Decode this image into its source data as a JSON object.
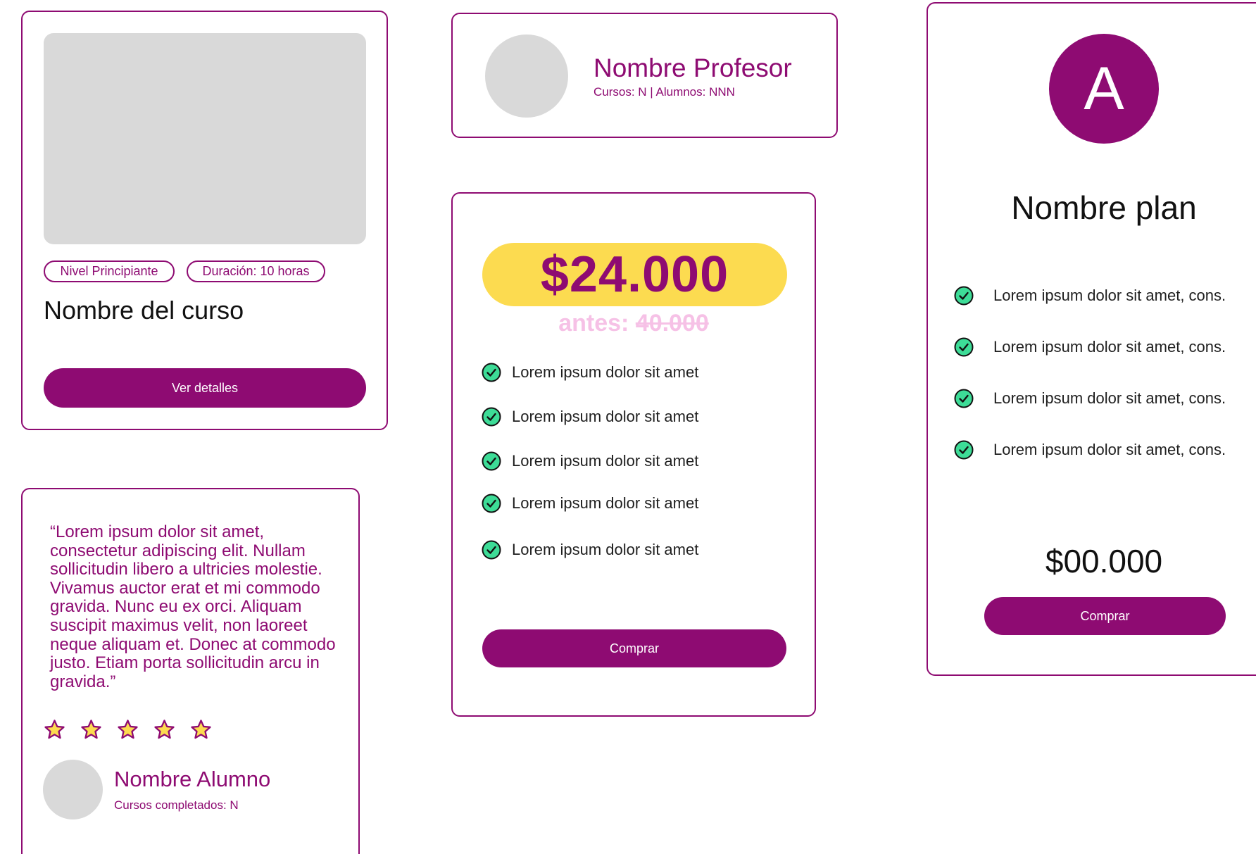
{
  "colors": {
    "brand": "#8e0b72",
    "highlight": "#fcdb50",
    "strike": "#f6c1e6",
    "check": "#3ddc97",
    "placeholder": "#d9d9d9",
    "star": "#fcdb50"
  },
  "course_card": {
    "tags": [
      "Nivel Principiante",
      "Duración: 10 horas"
    ],
    "title": "Nombre del curso",
    "button_label": "Ver detalles"
  },
  "testimonial_card": {
    "quote": "“Lorem ipsum dolor sit amet, consectetur adipiscing elit. Nullam sollicitudin libero a ultricies molestie. Vivamus auctor erat et mi commodo gravida. Nunc eu ex orci. Aliquam suscipit maximus velit, non laoreet neque aliquam et. Donec at commodo justo. Etiam porta sollicitudin arcu in gravida.”",
    "rating": 5,
    "rating_max": 5,
    "student_name": "Nombre Alumno",
    "student_sub": "Cursos completados: N"
  },
  "teacher_card": {
    "name": "Nombre Profesor",
    "sub": "Cursos: N | Alumnos: NNN"
  },
  "price_card": {
    "price": "$24.000",
    "before_label": "antes: ",
    "before_value": "40.000",
    "features": [
      "Lorem ipsum dolor sit amet",
      "Lorem ipsum dolor sit amet",
      "Lorem ipsum dolor sit amet",
      "Lorem ipsum dolor sit amet",
      "Lorem ipsum dolor sit amet"
    ],
    "button_label": "Comprar"
  },
  "plan_card": {
    "avatar_letter": "A",
    "name": "Nombre plan",
    "features": [
      "Lorem ipsum dolor sit amet, cons.",
      "Lorem ipsum dolor sit amet, cons.",
      "Lorem ipsum dolor sit amet, cons.",
      "Lorem ipsum dolor sit amet, cons."
    ],
    "price": "$00.000",
    "button_label": "Comprar"
  }
}
